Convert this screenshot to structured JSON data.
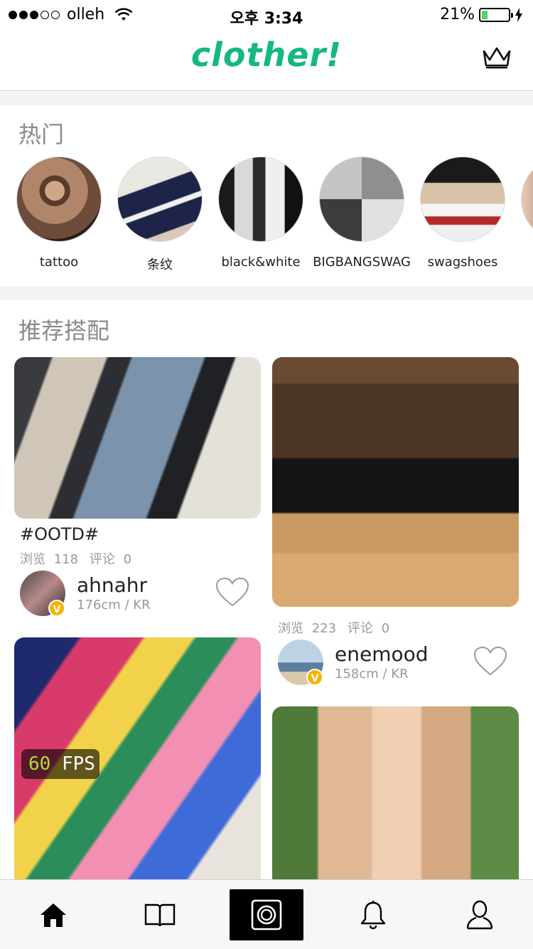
{
  "status_bar": {
    "carrier": "olleh",
    "time": "오후 3:34",
    "battery_percent": "21%",
    "battery_level": 0.21,
    "signal_bars_filled": 3,
    "signal_bars_total": 5
  },
  "header": {
    "logo": "clother!",
    "brand_color": "#13b97f"
  },
  "trending": {
    "title": "热门",
    "items": [
      {
        "label": "tattoo"
      },
      {
        "label": "条纹"
      },
      {
        "label": "black&white"
      },
      {
        "label": "BIGBANGSWAG"
      },
      {
        "label": "swagshoes"
      }
    ]
  },
  "recommended": {
    "title": "推荐搭配",
    "cards": [
      {
        "title": "#OOTD#",
        "views_label": "浏览",
        "views": "118",
        "comments_label": "评论",
        "comments": "0",
        "user": {
          "name": "ahnahr",
          "meta": "176cm / KR",
          "verified_mark": "V"
        }
      },
      {
        "title": "",
        "views_label": "浏览",
        "views": "223",
        "comments_label": "评论",
        "comments": "0",
        "user": {
          "name": "enemood",
          "meta": "158cm / KR",
          "verified_mark": "V"
        }
      }
    ]
  },
  "fps_overlay": {
    "value": "60",
    "unit": "FPS"
  },
  "tab_bar": {
    "tabs": [
      {
        "icon": "home-icon"
      },
      {
        "icon": "book-icon"
      },
      {
        "icon": "camera-icon"
      },
      {
        "icon": "bell-icon"
      },
      {
        "icon": "profile-icon"
      }
    ]
  }
}
